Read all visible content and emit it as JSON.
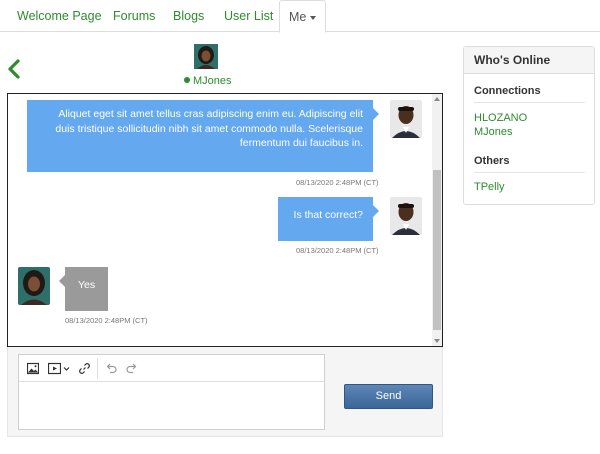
{
  "nav": {
    "tabs": [
      {
        "label": "Welcome Page"
      },
      {
        "label": "Forums"
      },
      {
        "label": "Blogs"
      },
      {
        "label": "User List"
      },
      {
        "label": "Me"
      }
    ]
  },
  "chat": {
    "peer_name": "MJones",
    "messages": [
      {
        "text": "Aliquet eget sit amet tellus cras adipiscing enim eu. Adipiscing elit duis tristique sollicitudin nibh sit amet commodo nulla. Scelerisque fermentum dui faucibus in.",
        "timestamp": "08/13/2020 2:48PM (CT)"
      },
      {
        "text": "Is that correct?",
        "timestamp": "08/13/2020 2:48PM (CT)"
      },
      {
        "text": "Yes",
        "timestamp": "08/13/2020 2:48PM (CT)"
      }
    ]
  },
  "composer": {
    "send_label": "Send"
  },
  "online": {
    "title": "Who's Online",
    "connections_title": "Connections",
    "connections": [
      "HLOZANO",
      "MJones"
    ],
    "others_title": "Others",
    "others": [
      "TPelly"
    ]
  },
  "colors": {
    "link_green": "#2e8b2e",
    "sent_bubble": "#64a8f0",
    "received_bubble": "#9a9a9a",
    "send_button": "#3a6699"
  }
}
